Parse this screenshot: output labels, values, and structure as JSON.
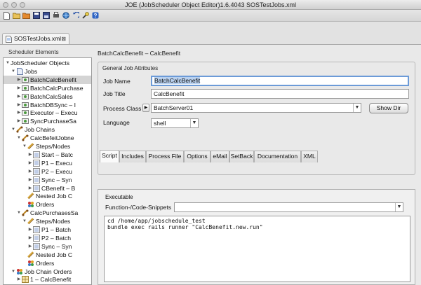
{
  "window": {
    "title": "JOE (JobScheduler Object Editor)1.6.4043 SOSTestJobs.xml"
  },
  "toolbar": {
    "icons": [
      "new-file-icon",
      "open-folder-icon",
      "open-hot-folder-icon",
      "save-icon",
      "save-as-icon",
      "print-icon",
      "globe-icon",
      "undo-icon",
      "tool-icon",
      "help-icon"
    ]
  },
  "editor_tab": {
    "label": "SOSTestJobs.xml",
    "close": "⊠"
  },
  "left_panel": {
    "title": "Scheduler Elements",
    "tree": [
      {
        "label": "JobScheduler Objects",
        "depth": 0,
        "arrow": "▼",
        "icon": "none"
      },
      {
        "label": "Jobs",
        "depth": 1,
        "arrow": "▼",
        "icon": "doc"
      },
      {
        "label": "BatchCalcBenefit",
        "depth": 2,
        "arrow": "▶",
        "icon": "job",
        "selected": true
      },
      {
        "label": "BatchCalcPurchase",
        "depth": 2,
        "arrow": "▶",
        "icon": "job"
      },
      {
        "label": "BatchCalcSales",
        "depth": 2,
        "arrow": "▶",
        "icon": "job"
      },
      {
        "label": "BatchDBSync – I",
        "depth": 2,
        "arrow": "▶",
        "icon": "job"
      },
      {
        "label": "Executor – Execu",
        "depth": 2,
        "arrow": "▶",
        "icon": "job"
      },
      {
        "label": "SyncPurchaseSa",
        "depth": 2,
        "arrow": "▶",
        "icon": "job"
      },
      {
        "label": "Job Chains",
        "depth": 1,
        "arrow": "▼",
        "icon": "chain"
      },
      {
        "label": "CalcBefeitJobne",
        "depth": 2,
        "arrow": "▼",
        "icon": "chain"
      },
      {
        "label": "Steps/Nodes",
        "depth": 3,
        "arrow": "▼",
        "icon": "steps"
      },
      {
        "label": "Start – Batc",
        "depth": 4,
        "arrow": "▶",
        "icon": "node"
      },
      {
        "label": "P1 – Execu",
        "depth": 4,
        "arrow": "▶",
        "icon": "node"
      },
      {
        "label": "P2 – Execu",
        "depth": 4,
        "arrow": "▶",
        "icon": "node"
      },
      {
        "label": "Sync – Syn",
        "depth": 4,
        "arrow": "▶",
        "icon": "node"
      },
      {
        "label": "CBenefit – B",
        "depth": 4,
        "arrow": "▶",
        "icon": "node"
      },
      {
        "label": "Nested Job C",
        "depth": 3,
        "arrow": "",
        "icon": "steps"
      },
      {
        "label": "Orders",
        "depth": 3,
        "arrow": "",
        "icon": "orders"
      },
      {
        "label": "CalcPurchasesSa",
        "depth": 2,
        "arrow": "▼",
        "icon": "chain"
      },
      {
        "label": "Steps/Nodes",
        "depth": 3,
        "arrow": "▼",
        "icon": "steps"
      },
      {
        "label": "P1 – Batch",
        "depth": 4,
        "arrow": "▶",
        "icon": "node"
      },
      {
        "label": "P2 – Batch",
        "depth": 4,
        "arrow": "▶",
        "icon": "node"
      },
      {
        "label": "Sync – Syn",
        "depth": 4,
        "arrow": "▶",
        "icon": "node"
      },
      {
        "label": "Nested Job C",
        "depth": 3,
        "arrow": "",
        "icon": "steps"
      },
      {
        "label": "Orders",
        "depth": 3,
        "arrow": "",
        "icon": "orders"
      },
      {
        "label": "Job Chain Orders",
        "depth": 1,
        "arrow": "▼",
        "icon": "orders"
      },
      {
        "label": "1 – CalcBenefit",
        "depth": 2,
        "arrow": "▶",
        "icon": "grid"
      }
    ]
  },
  "main": {
    "header": "BatchCalcBenefit – CalcBenefit",
    "group_title": "General Job Attributes",
    "job_name_label": "Job Name",
    "job_name_value": "BatchCalcBenefit",
    "job_title_label": "Job Title",
    "job_title_value": "CalcBenefit",
    "process_class_label": "Process Class",
    "process_class_value": "BatchServer01",
    "show_dir_button": "Show Dir",
    "language_label": "Language",
    "language_value": "shell",
    "tabs": [
      "Script",
      "Includes",
      "Process File",
      "Options",
      "eMail",
      "SetBack",
      "Documentation",
      "XML"
    ],
    "active_tab": "Script",
    "executable_title": "Executable",
    "function_label": "Function-/Code-Snippets",
    "function_value": "",
    "code_lines": [
      "cd /home/app/jobschedule_test",
      "bundle exec rails runner \"CalcBenefit.new.run\""
    ]
  }
}
